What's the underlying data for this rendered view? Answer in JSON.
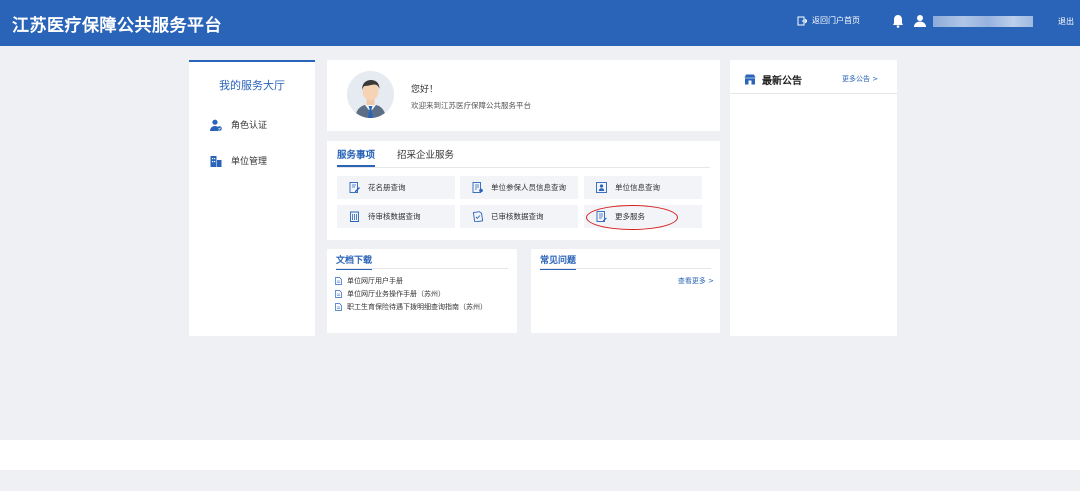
{
  "header": {
    "brand": "江苏医疗保障公共服务平台",
    "portal_link": "返回门户首页",
    "logout": "退出"
  },
  "sidebar": {
    "title": "我的服务大厅",
    "items": [
      {
        "label": "角色认证",
        "icon": "user-badge-icon"
      },
      {
        "label": "单位管理",
        "icon": "building-icon"
      }
    ]
  },
  "welcome": {
    "greeting": "您好！",
    "message": "欢迎来到江苏医疗保障公共服务平台"
  },
  "services": {
    "tabs": [
      {
        "label": "服务事项",
        "active": true
      },
      {
        "label": "招采企业服务",
        "active": false
      }
    ],
    "buttons": [
      {
        "label": "花名册查询",
        "icon": "edit-doc-icon"
      },
      {
        "label": "单位参保人员信息查询",
        "icon": "list-doc-icon"
      },
      {
        "label": "单位信息查询",
        "icon": "id-card-icon"
      },
      {
        "label": "待审核数据查询",
        "icon": "building-column-icon"
      },
      {
        "label": "已审核数据查询",
        "icon": "checked-doc-icon"
      },
      {
        "label": "更多服务",
        "icon": "more-doc-icon"
      }
    ]
  },
  "docs": {
    "title": "文档下载",
    "items": [
      "单位网厅用户手册",
      "单位网厅业务操作手册（苏州）",
      "职工生育保险待遇下拨明细查询指南（苏州）"
    ]
  },
  "faq": {
    "title": "常见问题",
    "more": "查看更多 >"
  },
  "notice": {
    "title": "最新公告",
    "more": "更多公告 >"
  },
  "colors": {
    "brand_blue": "#2a64b8",
    "highlight_red": "#d62020",
    "background": "#eef0f4"
  }
}
